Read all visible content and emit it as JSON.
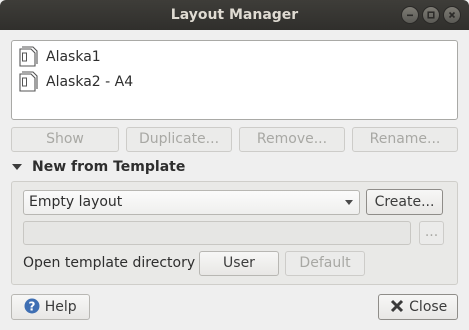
{
  "window": {
    "title": "Layout Manager"
  },
  "layouts": [
    {
      "name": "Alaska1"
    },
    {
      "name": "Alaska2 - A4"
    }
  ],
  "actions": {
    "show": "Show",
    "duplicate": "Duplicate...",
    "remove": "Remove...",
    "rename": "Rename..."
  },
  "template_section": {
    "title": "New from Template",
    "template_select": "Empty layout",
    "create": "Create...",
    "path_value": "",
    "browse": "...",
    "open_dir_label": "Open template directory",
    "user": "User",
    "default": "Default"
  },
  "footer": {
    "help": "Help",
    "close": "Close"
  }
}
